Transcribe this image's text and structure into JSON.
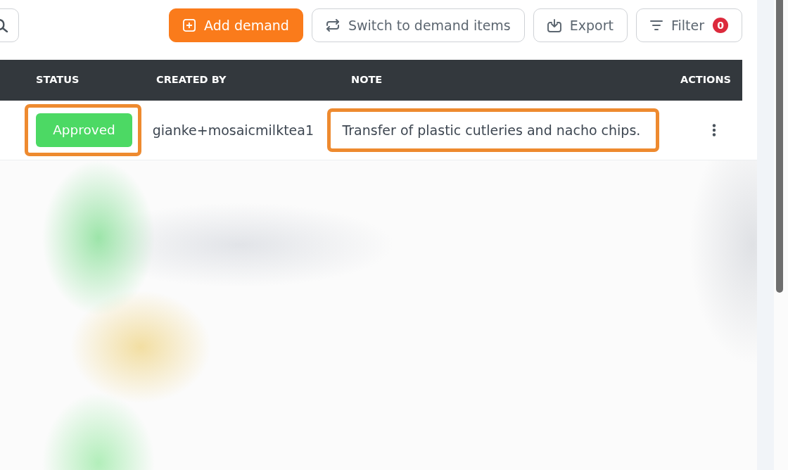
{
  "toolbar": {
    "buttons": [
      {
        "label": "Add demand",
        "kind": "primary"
      },
      {
        "label": "Switch to demand items",
        "kind": "outline"
      },
      {
        "label": "Export",
        "kind": "outline"
      },
      {
        "label": "Filter",
        "kind": "outline",
        "badge": "0"
      }
    ]
  },
  "table": {
    "columns": [
      "STATUS",
      "CREATED BY",
      "NOTE",
      "ACTIONS"
    ],
    "rows": [
      {
        "status": {
          "label": "Approved",
          "kind": "approved",
          "highlighted": true
        },
        "created_by": "gianke+mosaicmilktea1",
        "note": {
          "text": "Transfer of plastic cutleries and nacho chips.",
          "highlighted": true
        }
      }
    ]
  }
}
